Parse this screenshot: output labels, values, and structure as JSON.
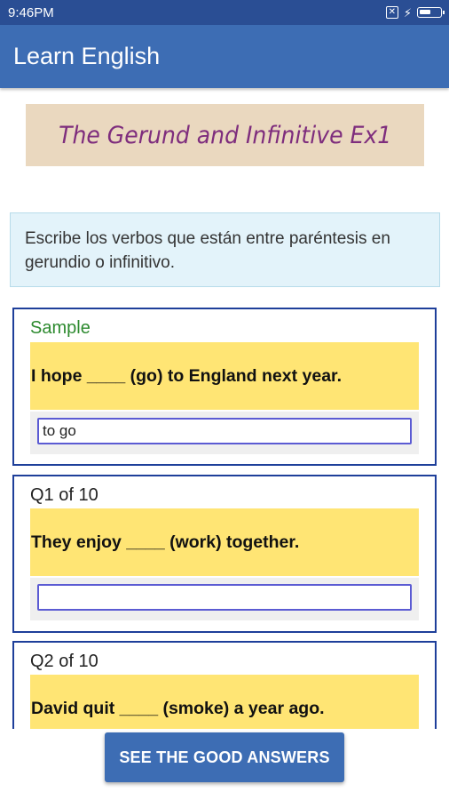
{
  "status_bar": {
    "time": "9:46PM",
    "sim_icon": "sim-blocked-icon",
    "charging_icon": "bolt-icon",
    "battery_icon": "battery-icon"
  },
  "app_bar": {
    "title": "Learn English",
    "color": "#3d6db4"
  },
  "exercise": {
    "title": "The Gerund and Infinitive Ex1",
    "instructions": "Escribe los verbos que están entre paréntesis en gerundio o infinitivo."
  },
  "sample": {
    "label": "Sample",
    "question": "I hope ____ (go) to England next year.",
    "answer_value": "to go"
  },
  "questions": [
    {
      "label": "Q1 of 10",
      "question": "They enjoy ____ (work) together.",
      "answer_value": ""
    },
    {
      "label": "Q2 of 10",
      "question": "David quit ____ (smoke) a year ago.",
      "answer_value": ""
    }
  ],
  "actions": {
    "see_answers_label": "SEE THE GOOD ANSWERS"
  },
  "colors": {
    "status_bar": "#2a4e94",
    "banner": "#ead8bf",
    "title_text": "#7e2d7d",
    "question_bg": "#ffe574",
    "card_border": "#1e3f9a",
    "sample_label": "#2d8a2f"
  }
}
